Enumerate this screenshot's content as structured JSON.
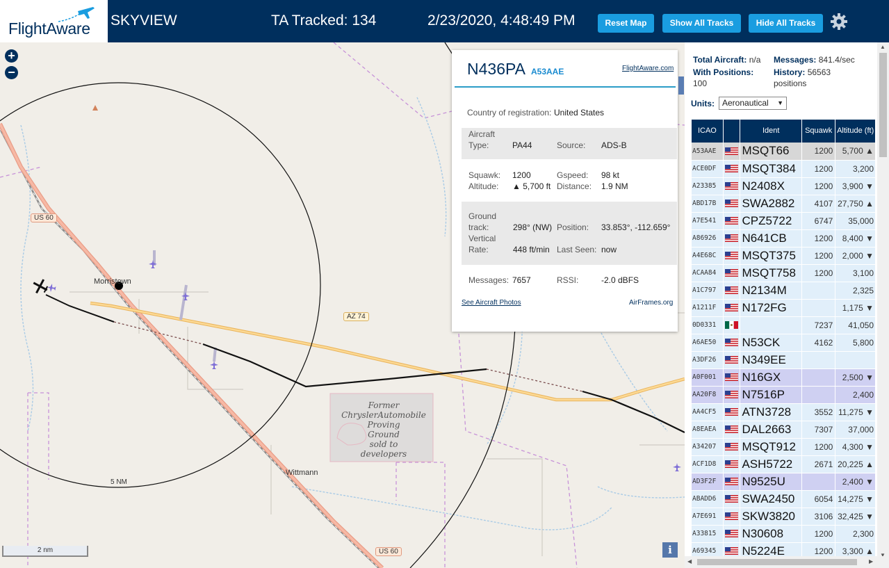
{
  "header": {
    "logo_text": "FlightAware",
    "app_name": "SKYVIEW",
    "ta_tracked": "TA Tracked: 134",
    "datetime": "2/23/2020, 4:48:49 PM",
    "buttons": {
      "reset_map": "Reset Map",
      "show_all_tracks": "Show All Tracks",
      "hide_all_tracks": "Hide All Tracks"
    }
  },
  "map": {
    "labels": {
      "morristown": "Morristown",
      "wittmann": "Wittmann",
      "range_ring": "5 NM",
      "scale": "2 nm",
      "former_site": [
        "Former",
        "ChryslerAutomobile",
        "Proving",
        "Ground",
        "sold to",
        "developers"
      ]
    },
    "shields": {
      "us60_top": "US 60",
      "az74": "AZ 74",
      "us60_bottom": "US 60"
    },
    "info_button": "i"
  },
  "popup": {
    "ident": "N436PA",
    "icao": "A53AAE",
    "fa_link": "FlightAware.com",
    "country_label": "Country of registration:",
    "country_value": "United States",
    "aircraft_type_label": [
      "Aircraft",
      "Type:"
    ],
    "aircraft_type_value": "PA44",
    "source_label": "Source:",
    "source_value": "ADS-B",
    "squawk_label": "Squawk:",
    "squawk_value": "1200",
    "altitude_label": "Altitude:",
    "altitude_value": "▲ 5,700 ft",
    "gspeed_label": "Gspeed:",
    "gspeed_value": "98 kt",
    "distance_label": "Distance:",
    "distance_value": "1.9 NM",
    "ground_track_label": [
      "Ground",
      "track:"
    ],
    "ground_track_value": "298° (NW)",
    "position_label": "Position:",
    "position_value": "33.853°, -112.659°",
    "vertical_rate_label": [
      "Vertical",
      "Rate:"
    ],
    "vertical_rate_value": "448 ft/min",
    "last_seen_label": "Last Seen:",
    "last_seen_value": "now",
    "messages_label": "Messages:",
    "messages_value": "7657",
    "rssi_label": "RSSI:",
    "rssi_value": "-2.0 dBFS",
    "photos_link": "See Aircraft Photos",
    "airframes_link": "AirFrames.org"
  },
  "sidebar": {
    "total_aircraft_label": "Total Aircraft:",
    "total_aircraft_value": "n/a",
    "messages_label": "Messages:",
    "messages_value": "841.4/sec",
    "with_positions_label": "With Positions:",
    "with_positions_value": "100",
    "history_label": "History:",
    "history_value": "56563",
    "history_unit": "positions",
    "units_label": "Units:",
    "units_value": "Aeronautical",
    "columns": [
      "ICAO",
      "",
      "Ident",
      "Squawk",
      "Altitude (ft)"
    ],
    "colors": {
      "header_bg": "#002f5d",
      "row_bg": "#e1effa",
      "selected_row_bg": "#cfd0f2"
    },
    "rows": [
      {
        "icao": "A53AAE",
        "flag": "us",
        "ident": "MSQT66",
        "squawk": "1200",
        "altitude": "5,700 ▲",
        "state": "first"
      },
      {
        "icao": "ACE0DF",
        "flag": "us",
        "ident": "MSQT384",
        "squawk": "1200",
        "altitude": "3,200",
        "state": ""
      },
      {
        "icao": "A23385",
        "flag": "us",
        "ident": "N2408X",
        "squawk": "1200",
        "altitude": "3,900 ▼",
        "state": ""
      },
      {
        "icao": "ABD17B",
        "flag": "us",
        "ident": "SWA2882",
        "squawk": "4107",
        "altitude": "27,750 ▲",
        "state": ""
      },
      {
        "icao": "A7E541",
        "flag": "us",
        "ident": "CPZ5722",
        "squawk": "6747",
        "altitude": "35,000",
        "state": ""
      },
      {
        "icao": "A86926",
        "flag": "us",
        "ident": "N641CB",
        "squawk": "1200",
        "altitude": "8,400 ▼",
        "state": ""
      },
      {
        "icao": "A4E68C",
        "flag": "us",
        "ident": "MSQT375",
        "squawk": "1200",
        "altitude": "2,000 ▼",
        "state": ""
      },
      {
        "icao": "ACAA84",
        "flag": "us",
        "ident": "MSQT758",
        "squawk": "1200",
        "altitude": "3,100",
        "state": ""
      },
      {
        "icao": "A1C797",
        "flag": "us",
        "ident": "N2134M",
        "squawk": "",
        "altitude": "2,325",
        "state": ""
      },
      {
        "icao": "A1211F",
        "flag": "us",
        "ident": "N172FG",
        "squawk": "",
        "altitude": "1,175 ▼",
        "state": ""
      },
      {
        "icao": "0D0331",
        "flag": "mx",
        "ident": "",
        "squawk": "7237",
        "altitude": "41,050",
        "state": ""
      },
      {
        "icao": "A6AE50",
        "flag": "us",
        "ident": "N53CK",
        "squawk": "4162",
        "altitude": "5,800",
        "state": ""
      },
      {
        "icao": "A3DF26",
        "flag": "us",
        "ident": "N349EE",
        "squawk": "",
        "altitude": "",
        "state": ""
      },
      {
        "icao": "A0F001",
        "flag": "us",
        "ident": "N16GX",
        "squawk": "",
        "altitude": "2,500 ▼",
        "state": "sel"
      },
      {
        "icao": "AA20F8",
        "flag": "us",
        "ident": "N7516P",
        "squawk": "",
        "altitude": "2,400",
        "state": "sel"
      },
      {
        "icao": "AA4CF5",
        "flag": "us",
        "ident": "ATN3728",
        "squawk": "3552",
        "altitude": "11,275 ▼",
        "state": ""
      },
      {
        "icao": "A8EAEA",
        "flag": "us",
        "ident": "DAL2663",
        "squawk": "7307",
        "altitude": "37,000",
        "state": ""
      },
      {
        "icao": "A34207",
        "flag": "us",
        "ident": "MSQT912",
        "squawk": "1200",
        "altitude": "4,300 ▼",
        "state": ""
      },
      {
        "icao": "ACF1D8",
        "flag": "us",
        "ident": "ASH5722",
        "squawk": "2671",
        "altitude": "20,225 ▲",
        "state": ""
      },
      {
        "icao": "AD3F2F",
        "flag": "us",
        "ident": "N9525U",
        "squawk": "",
        "altitude": "2,400 ▼",
        "state": "sel"
      },
      {
        "icao": "ABADD6",
        "flag": "us",
        "ident": "SWA2450",
        "squawk": "6054",
        "altitude": "14,275 ▼",
        "state": ""
      },
      {
        "icao": "A7E691",
        "flag": "us",
        "ident": "SKW3820",
        "squawk": "3106",
        "altitude": "32,425 ▼",
        "state": ""
      },
      {
        "icao": "A33815",
        "flag": "us",
        "ident": "N30608",
        "squawk": "1200",
        "altitude": "2,300",
        "state": ""
      },
      {
        "icao": "A69345",
        "flag": "us",
        "ident": "N5224E",
        "squawk": "1200",
        "altitude": "3,300 ▲",
        "state": ""
      }
    ]
  }
}
